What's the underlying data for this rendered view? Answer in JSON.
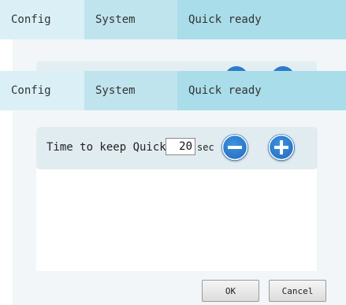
{
  "background_dialog": {
    "tabs": [
      {
        "label": "Config"
      },
      {
        "label": "System"
      },
      {
        "label": "Quick ready"
      }
    ]
  },
  "dialog": {
    "tabs": [
      {
        "label": "Config"
      },
      {
        "label": "System"
      },
      {
        "label": "Quick ready"
      }
    ],
    "quick_setting": {
      "label": "Time to keep Quick",
      "value": "20",
      "unit": "sec",
      "decrease_icon": "minus-icon",
      "increase_icon": "plus-icon"
    },
    "buttons": {
      "ok": "OK",
      "cancel": "Cancel"
    }
  },
  "colors": {
    "tab_active": "#daf0f6",
    "tab_bar": "#a9dde9",
    "accent": "#2e7bc9",
    "panel": "#e1ecf0"
  }
}
